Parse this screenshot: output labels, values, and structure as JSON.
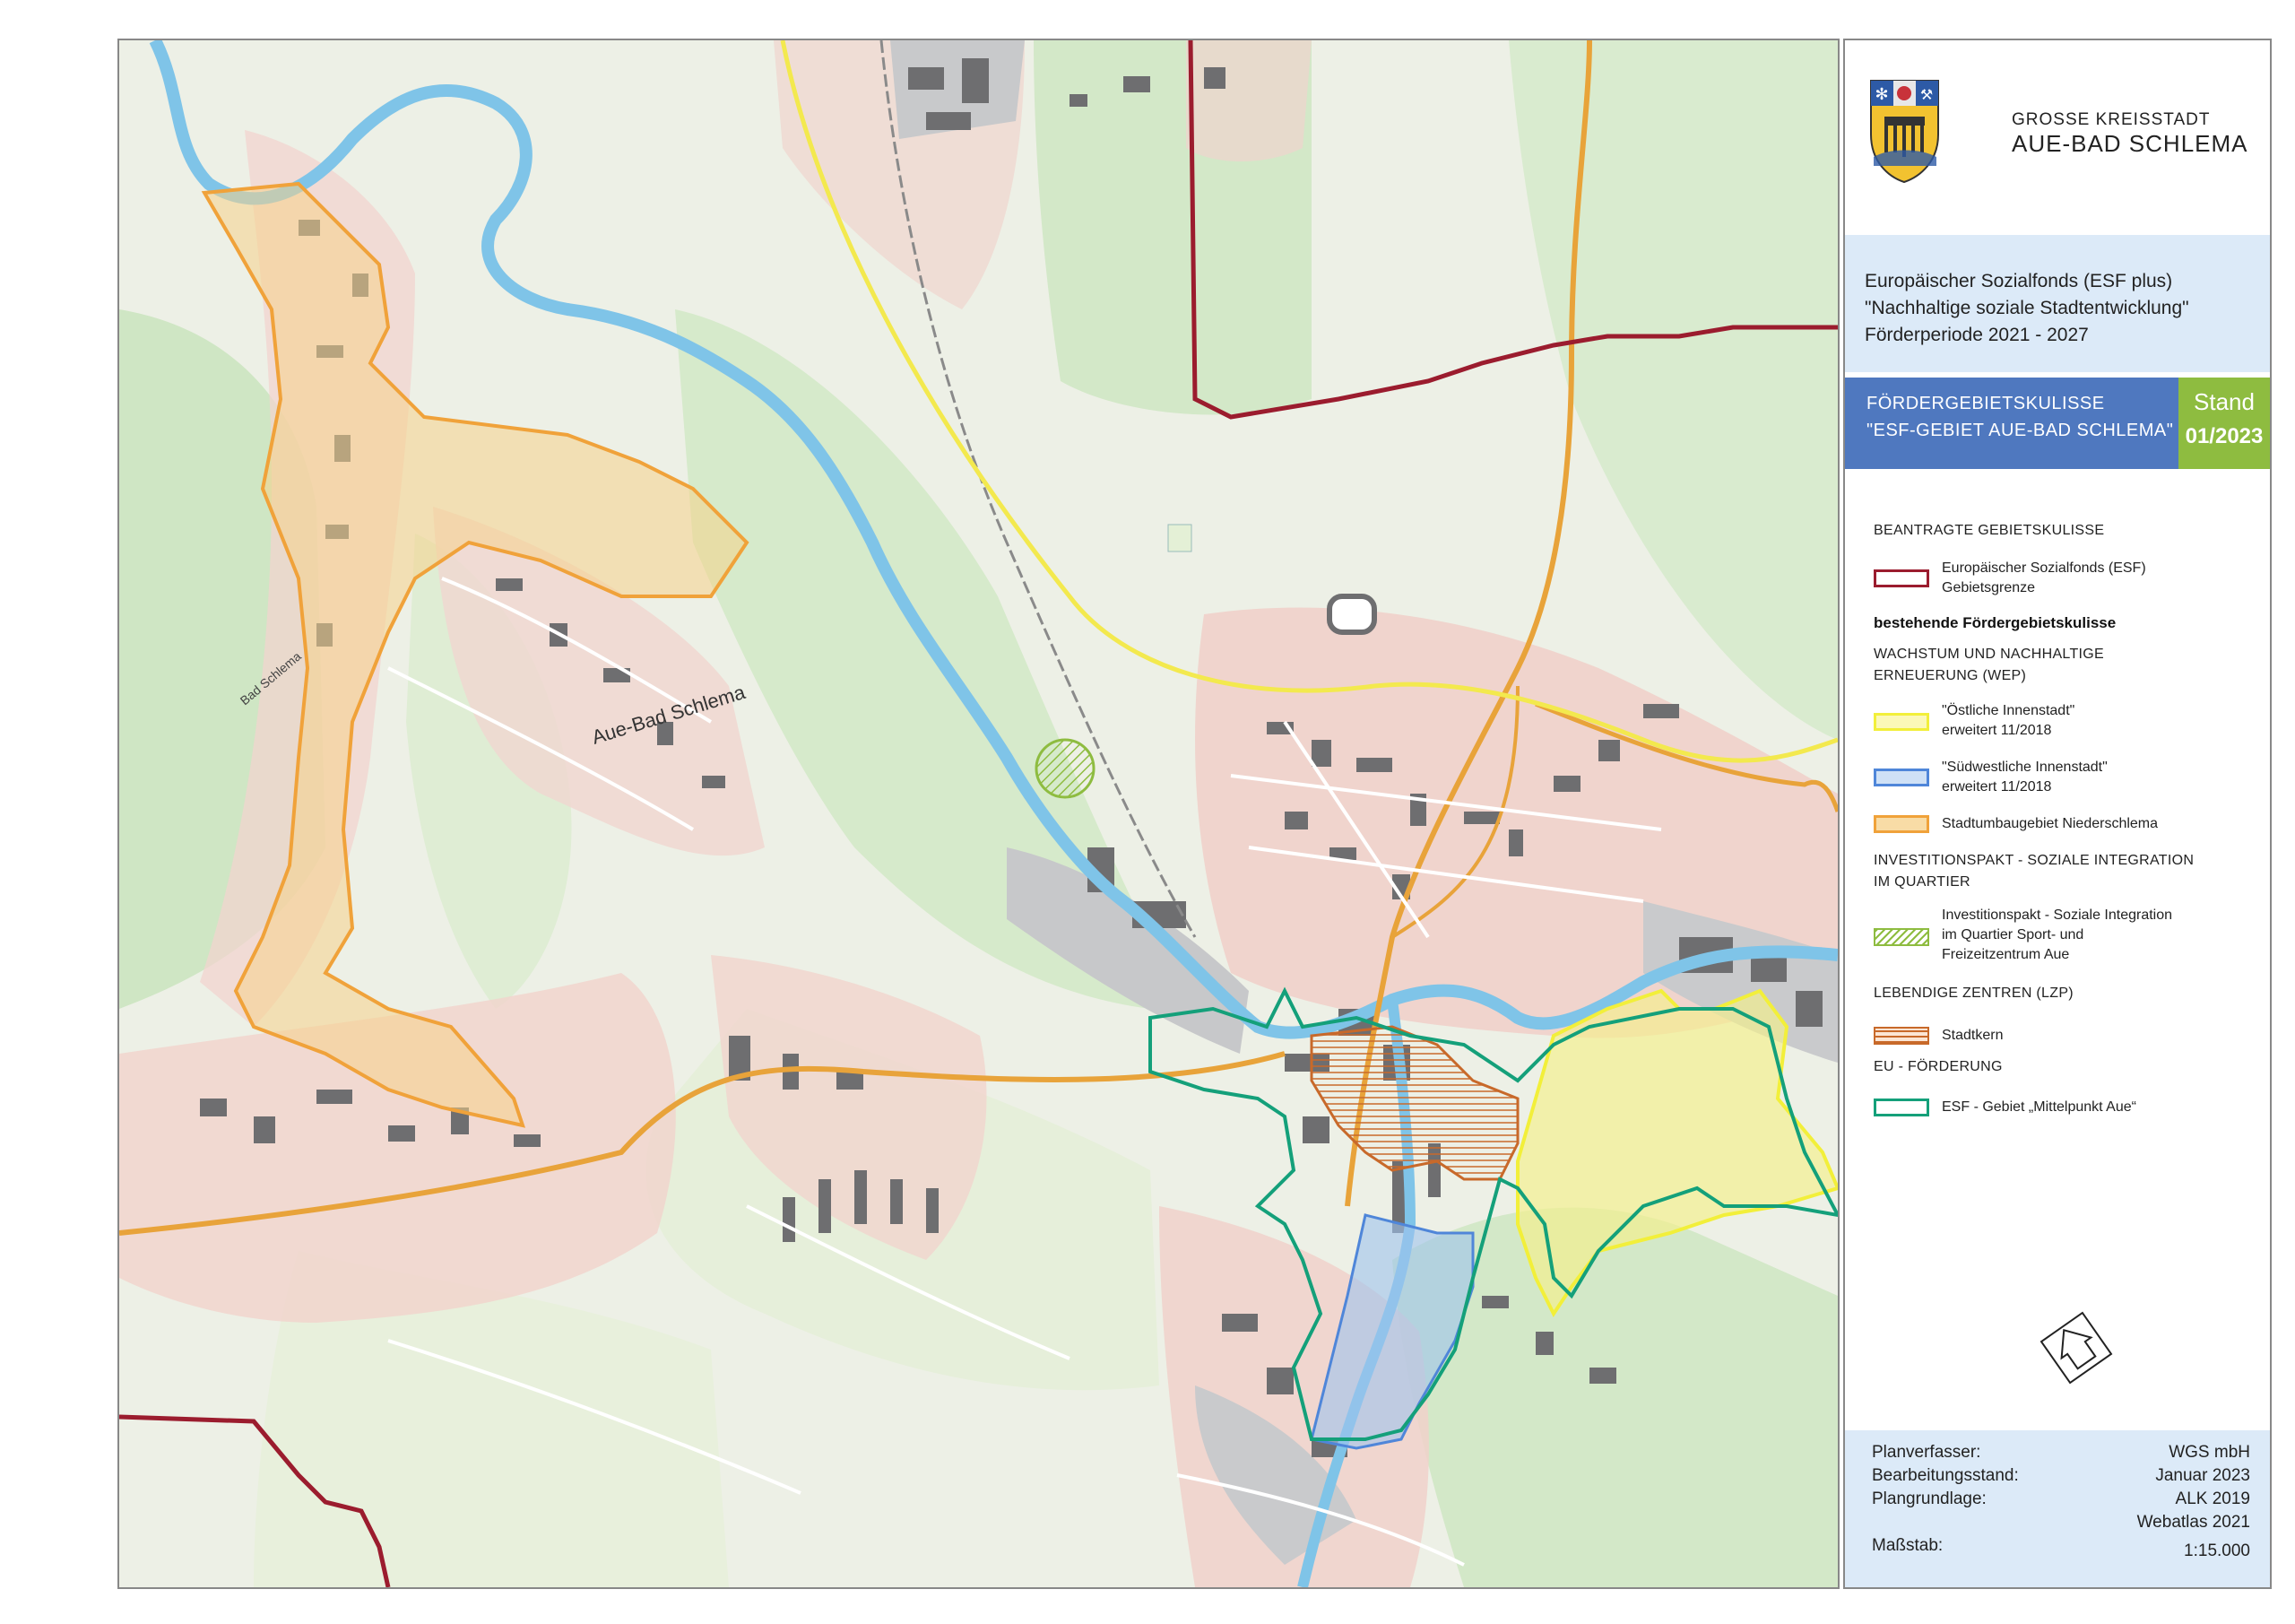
{
  "header": {
    "city_top": "GROSSE KREISSTADT",
    "city_main": "AUE-BAD SCHLEMA"
  },
  "program": {
    "line1": "Europäischer Sozialfonds (ESF plus)",
    "line2": "\"Nachhaltige soziale Stadtentwicklung\"",
    "line3": "Förderperiode 2021 - 2027"
  },
  "title": {
    "line1": "FÖRDERGEBIETSKULISSE",
    "line2": "\"ESF-GEBIET AUE-BAD SCHLEMA\"",
    "stand_label": "Stand",
    "stand_value": "01/2023"
  },
  "legend": {
    "heading_applied": "BEANTRAGTE GEBIETSKULISSE",
    "esf_boundary_l1": "Europäischer Sozialfonds (ESF)",
    "esf_boundary_l2": "Gebietsgrenze",
    "heading_existing": "bestehende Fördergebietskulisse",
    "heading_wep_l1": "WACHSTUM UND NACHHALTIGE",
    "heading_wep_l2": "ERNEUERUNG (WEP)",
    "east_l1": "\"Östliche Innenstadt\"",
    "east_l2": "erweitert 11/2018",
    "southwest_l1": "\"Südwestliche Innenstadt\"",
    "southwest_l2": "erweitert 11/2018",
    "niederschlema": "Stadtumbaugebiet Niederschlema",
    "heading_invest_l1": "INVESTITIONSPAKT - SOZIALE INTEGRATION",
    "heading_invest_l2": "IM QUARTIER",
    "invest_l1": "Investitionspakt - Soziale Integration",
    "invest_l2": "im Quartier Sport- und",
    "invest_l3": "Freizeitzentrum Aue",
    "heading_lzp": "LEBENDIGE ZENTREN (LZP)",
    "stadtkern": "Stadtkern",
    "heading_eu": "EU - FÖRDERUNG",
    "esf_mittelpunkt": "ESF - Gebiet „Mittelpunkt Aue“"
  },
  "footer": {
    "planverfasser_label": "Planverfasser:",
    "planverfasser_value": "WGS mbH",
    "bearbeitung_label": "Bearbeitungsstand:",
    "bearbeitung_value": "Januar 2023",
    "plangrundlage_label": "Plangrundlage:",
    "plangrundlage_value1": "ALK 2019",
    "plangrundlage_value2": "Webatlas 2021",
    "massstab_label": "Maßstab:",
    "massstab_value": "1:15.000"
  },
  "map": {
    "place_label": "Aue-Bad Schlema",
    "place_label_small": "Bad Schlema"
  },
  "colors": {
    "esf_boundary": "#9b1c2e",
    "east_inner_city": "#f2ef3a",
    "southwest_inner_city": "#4f86d9",
    "niederschlema": "#f0a23a",
    "invest_pakt": "#8ebc40",
    "stadtkern": "#c8692a",
    "esf_mittelpunkt": "#14a07a",
    "river": "#7fc4e8",
    "accent_blue": "#4f78bf",
    "accent_green": "#8ebc40"
  },
  "icons": {
    "logo": "city-coat-of-arms-icon",
    "north": "north-arrow-icon"
  }
}
